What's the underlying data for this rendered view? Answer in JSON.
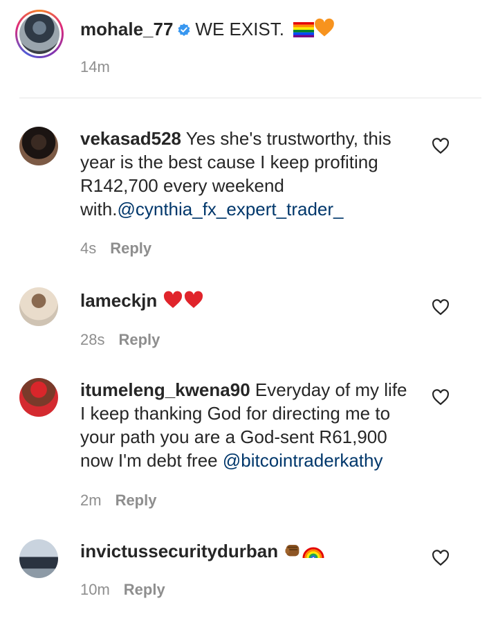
{
  "caption": {
    "username": "mohale_77",
    "text": "WE EXIST.",
    "time": "14m"
  },
  "comments": [
    {
      "username": "vekasad528",
      "text_lines": [
        "Yes she's trustworthy, this",
        "year is the best cause I keep profiting",
        "R142,700 every weekend",
        "with."
      ],
      "mention": "@cynthia_fx_expert_trader_",
      "time": "4s",
      "reply_label": "Reply"
    },
    {
      "username": "lameckjn",
      "time": "28s",
      "reply_label": "Reply"
    },
    {
      "username": "itumeleng_kwena90",
      "text_lines": [
        "Everyday of my life",
        "I keep thanking God for directing me to",
        "your path you are a God-sent R61,900",
        "now I'm debt free "
      ],
      "mention": "@bitcointraderkathy",
      "time": "2m",
      "reply_label": "Reply"
    },
    {
      "username": "invictussecuritydurban",
      "time": "10m",
      "reply_label": "Reply"
    }
  ],
  "icons": {
    "verified": "verified-badge-icon",
    "heart": "heart-outline-icon",
    "colors": {
      "verified": "#3897f0",
      "mention": "#00376b",
      "meta": "#8e8e8e"
    }
  }
}
